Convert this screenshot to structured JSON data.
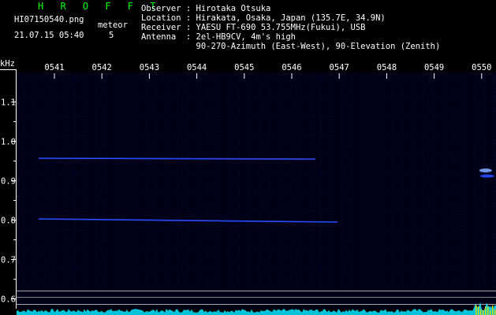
{
  "header": {
    "title": "H R O F F T",
    "filename": "HI07150540.png",
    "datetime": "21.07.15 05:40",
    "meteor_label": "meteor",
    "meteor_count": "5",
    "title_color": "#00ff00",
    "info": [
      "Observer : Hirotaka Otsuka",
      "Location : Hirakata, Osaka, Japan (135.7E, 34.9N)",
      "Receiver : YAESU FT-690 53.755MHz(Fukui), USB",
      "Antenna  : 2el-HB9CV, 4m's high",
      "           90-270-Azimuth (East-West), 90-Elevation (Zenith)"
    ]
  },
  "chart_data": {
    "type": "heatmap",
    "ylabel": "kHz",
    "ylim": [
      0.6,
      1.1
    ],
    "y_ticks": [
      "1.1",
      "1.0",
      "0.9",
      "0.8",
      "0.7",
      "0.6"
    ],
    "x_ticks": [
      "0541",
      "0542",
      "0543",
      "0544",
      "0545",
      "0546",
      "0547",
      "0548",
      "0549",
      "0550"
    ],
    "grid": true,
    "background_color": "#000018",
    "signal_color": "#2a4cff",
    "echo_color": "#7fa6ff",
    "ref_line_color": "#bbbbbb",
    "baseline_color": "#00e5ff",
    "carrier_traces": [
      {
        "x_start": "0540:40",
        "x_end": "0546:30",
        "y_start": 0.957,
        "y_end": 0.955
      },
      {
        "x_start": "0540:40",
        "x_end": "0546:58",
        "y_start": 0.803,
        "y_end": 0.795
      }
    ],
    "meteor_echoes": [
      {
        "x": "0550:05",
        "y": 0.92
      }
    ]
  }
}
